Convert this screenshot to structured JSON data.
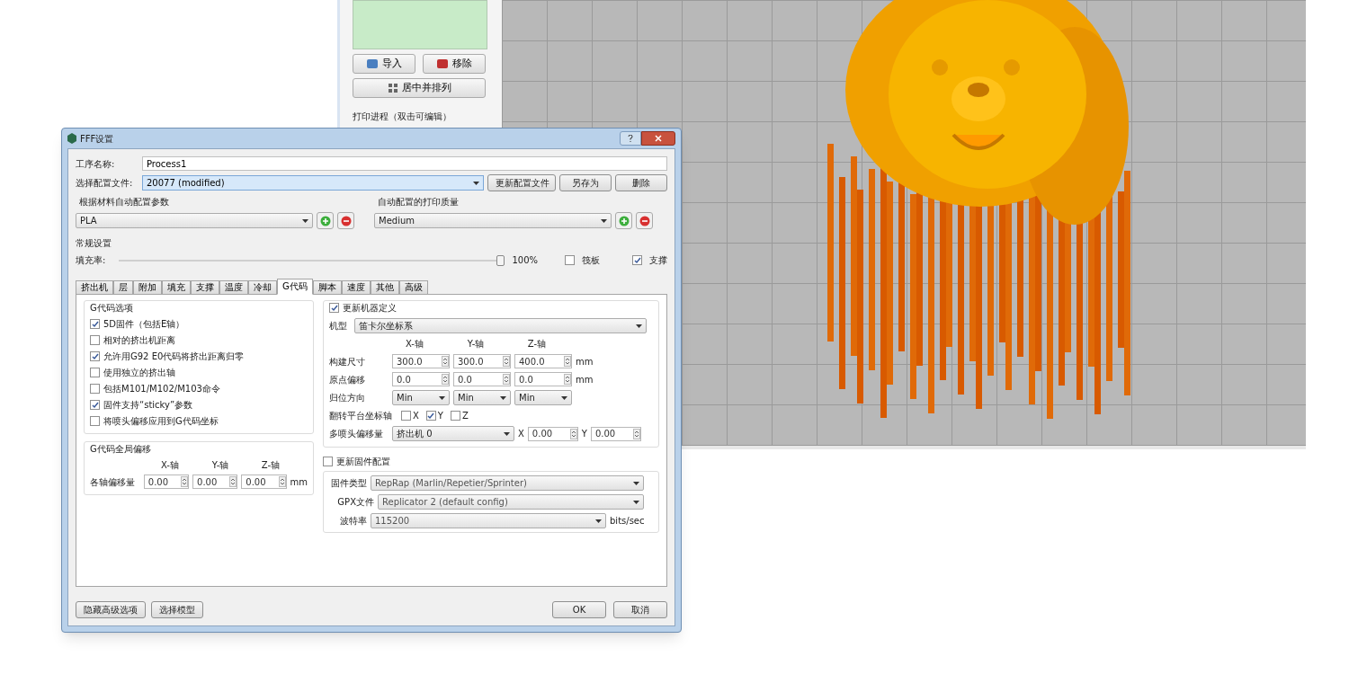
{
  "side_panel": {
    "buttons": [
      {
        "label": "导入"
      },
      {
        "label": "移除"
      }
    ],
    "arrange_button": "居中并排列",
    "process_label": "打印进程（双击可编辑）"
  },
  "dialog": {
    "title": "FFF设置",
    "process_name": {
      "label": "工序名称:",
      "value": "Process1"
    },
    "profile": {
      "label": "选择配置文件:",
      "value": "20077 (modified)",
      "buttons": [
        "更新配置文件",
        "另存为",
        "删除"
      ]
    },
    "material": {
      "label": "根据材料自动配置参数",
      "value": "PLA"
    },
    "quality": {
      "label": "自动配置的打印质量",
      "value": "Medium"
    },
    "general": {
      "title": "常规设置",
      "infill_label": "填充率:",
      "infill": {
        "level": 1.0
      },
      "infill_reading": "100%",
      "raft": {
        "label": "筏板",
        "checked": false
      },
      "support": {
        "label": "支撑",
        "checked": true
      }
    },
    "tabs": [
      {
        "label": "挤出机",
        "selected": false
      },
      {
        "label": "层",
        "selected": false
      },
      {
        "label": "附加",
        "selected": false
      },
      {
        "label": "填充",
        "selected": false
      },
      {
        "label": "支撑",
        "selected": false
      },
      {
        "label": "温度",
        "selected": false
      },
      {
        "label": "冷却",
        "selected": false
      },
      {
        "label": "G代码",
        "selected": true
      },
      {
        "label": "脚本",
        "selected": false
      },
      {
        "label": "速度",
        "selected": false
      },
      {
        "label": "其他",
        "selected": false
      },
      {
        "label": "高级",
        "selected": false
      }
    ],
    "gcode_options": {
      "title": "G代码选项",
      "items": [
        {
          "label": "5D固件（包括E轴）",
          "checked": true
        },
        {
          "label": "相对的挤出机距离",
          "checked": false
        },
        {
          "label": "允许用G92 E0代码将挤出距离归零",
          "checked": true
        },
        {
          "label": "使用独立的挤出轴",
          "checked": false
        },
        {
          "label": "包括M101/M102/M103命令",
          "checked": false
        },
        {
          "label": "固件支持“sticky”参数",
          "checked": true
        },
        {
          "label": "将喷头偏移应用到G代码坐标",
          "checked": false
        }
      ]
    },
    "global_offset": {
      "title": "G代码全局偏移",
      "axes": [
        "X-轴",
        "Y-轴",
        "Z-轴"
      ],
      "label": "各轴偏移量",
      "values": [
        "0.00",
        "0.00",
        "0.00"
      ],
      "unit": "mm"
    },
    "machine": {
      "label": "更新机器定义",
      "checked": true,
      "type_label": "机型",
      "type_value": "笛卡尔坐标系",
      "axes": [
        "X-轴",
        "Y-轴",
        "Z-轴"
      ],
      "rows": [
        {
          "label": "构建尺寸",
          "kind": "spin",
          "values": [
            "300.0",
            "300.0",
            "400.0"
          ],
          "unit": "mm"
        },
        {
          "label": "原点偏移",
          "kind": "spin",
          "values": [
            "0.0",
            "0.0",
            "0.0"
          ],
          "unit": "mm"
        },
        {
          "label": "归位方向",
          "kind": "select",
          "values": [
            "Min",
            "Min",
            "Min"
          ]
        }
      ],
      "flip": {
        "label": "翻转平台坐标轴",
        "axes": [
          {
            "label": "X",
            "checked": false
          },
          {
            "label": "Y",
            "checked": true
          },
          {
            "label": "Z",
            "checked": false
          }
        ]
      },
      "nozzle": {
        "label": "多喷头偏移量",
        "extruder": "挤出机 0",
        "x_label": "X",
        "x_value": "0.00",
        "y_label": "Y",
        "y_value": "0.00"
      }
    },
    "firmware": {
      "label": "更新固件配置",
      "checked": false,
      "rows": [
        {
          "label": "固件类型",
          "value": "RepRap (Marlin/Repetier/Sprinter)"
        },
        {
          "label": "GPX文件",
          "value": "Replicator 2 (default config)"
        },
        {
          "label": "波特率",
          "value": "115200",
          "unit": "bits/sec"
        }
      ]
    },
    "footer": {
      "left_buttons": [
        "隐藏高级选项",
        "选择模型"
      ],
      "ok": "OK",
      "cancel": "取消"
    }
  }
}
